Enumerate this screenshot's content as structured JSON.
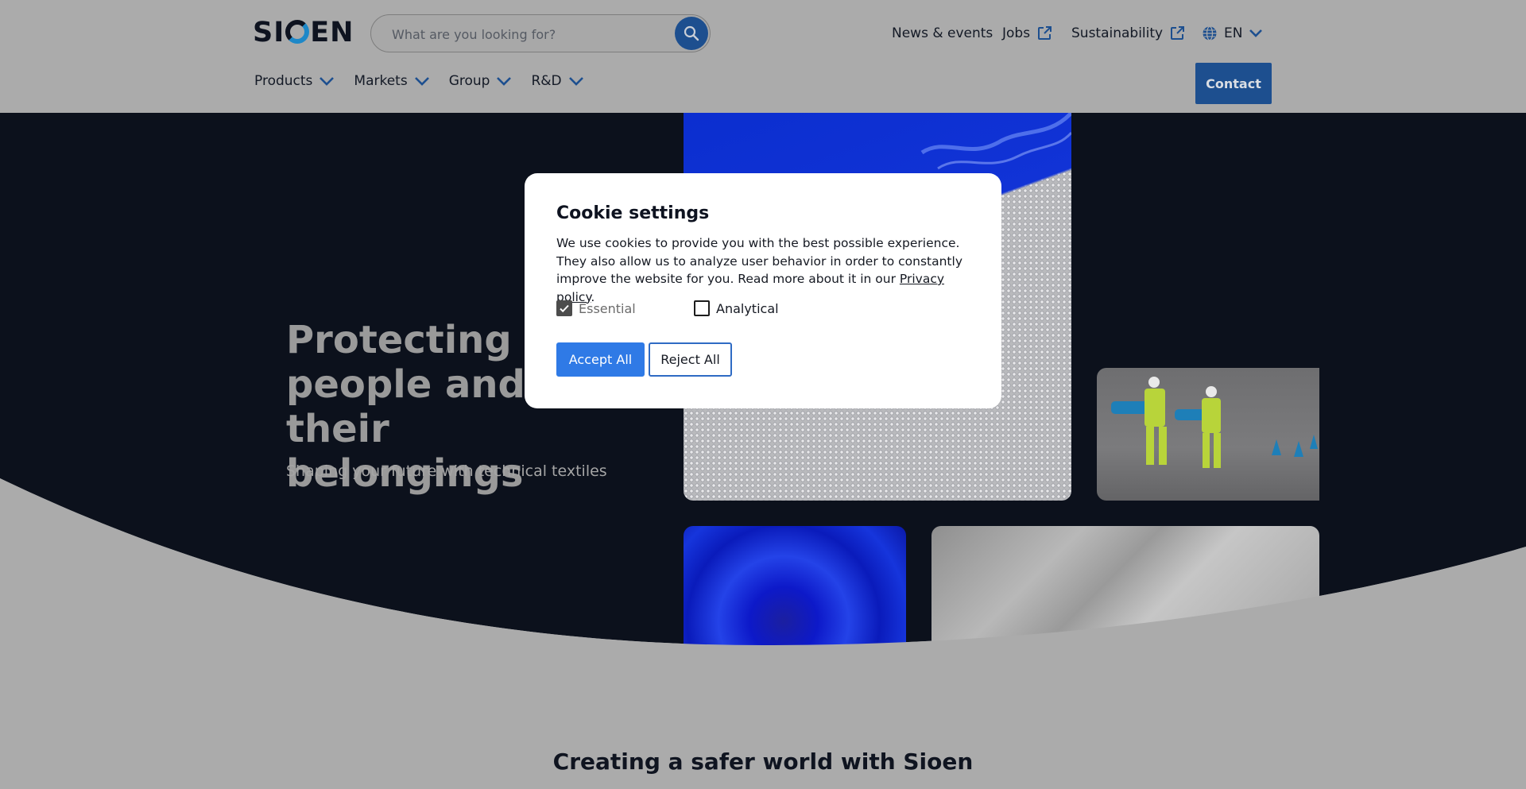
{
  "header": {
    "logo_text": "SIOEN",
    "search": {
      "placeholder": "What are you looking for?"
    },
    "top_nav": {
      "news": "News & events",
      "jobs": "Jobs",
      "sustainability": "Sustainability",
      "language": "EN"
    },
    "main_nav": [
      "Products",
      "Markets",
      "Group",
      "R&D"
    ],
    "contact_label": "Contact"
  },
  "hero": {
    "title": "Protecting people and their belongings",
    "subtitle": "Shaping your future with technical textiles",
    "section_title": "Creating a safer world with Sioen"
  },
  "cookie_modal": {
    "title": "Cookie settings",
    "text": "We use cookies to provide you with the best possible experience. They also allow us to analyze user behavior in order to constantly improve the website for you. Read more about it in our ",
    "privacy_link": "Privacy policy",
    "text_end": ".",
    "options": [
      {
        "label": "Essential",
        "checked": true
      },
      {
        "label": "Analytical",
        "checked": false
      }
    ],
    "accept_label": "Accept All",
    "reject_label": "Reject All"
  },
  "colors": {
    "accent": "#2f7ae6",
    "dark_navy": "#0c111c",
    "overlay_gray": "#ababab"
  },
  "icons": [
    "search-icon",
    "external-link-icon",
    "globe-icon",
    "chevron-down-icon",
    "checkmark-icon"
  ]
}
